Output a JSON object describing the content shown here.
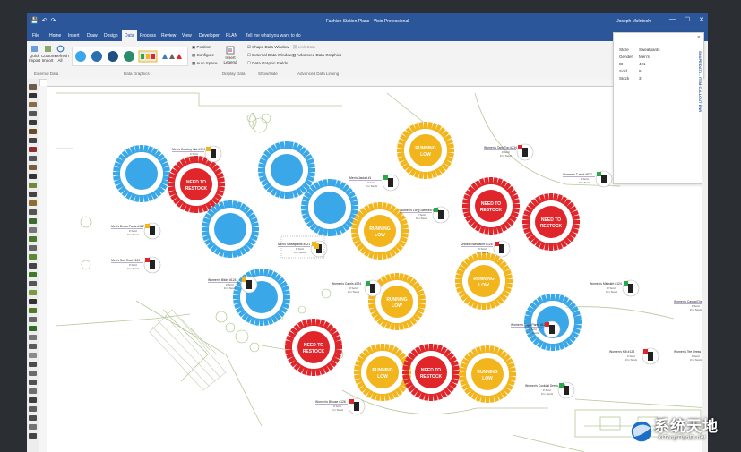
{
  "app": {
    "title": "Fashion Station Plans - Visio Professional",
    "user": "Joseph McIntosh",
    "min": "—",
    "max": "☐",
    "close": "✕",
    "qat": [
      "💾",
      "↶",
      "↷"
    ]
  },
  "menu": {
    "tabs": [
      "File",
      "Home",
      "Insert",
      "Draw",
      "Design",
      "Data",
      "Process",
      "Review",
      "View",
      "Developer",
      "PLAN"
    ],
    "active": "Data",
    "tellme": "Tell me what you want to do"
  },
  "ribbon": {
    "external": {
      "quick": "Quick Import",
      "custom": "Custom Import",
      "refresh": "Refresh All",
      "label": "External Data"
    },
    "graphics": {
      "label": "Data Graphics"
    },
    "position": {
      "position": "Position",
      "configure": "Configure",
      "autospace": "Auto Space"
    },
    "legend": {
      "insert": "Insert Legend",
      "label": "Display Data"
    },
    "showhide": {
      "shape_window": "Shape Data Window",
      "ext_window": "External Data Window",
      "fields": "Data Graphic Fields",
      "label": "Show/Hide"
    },
    "advanced": {
      "link": "Link Data",
      "graphics": "Advanced Data Graphics",
      "label": "Advanced Data Linking"
    }
  },
  "shape_data": {
    "title": "SHAPE DATA - ITEM CALLOUT ENR",
    "rows": [
      {
        "k": "Store",
        "v": "Sweatpants"
      },
      {
        "k": "Gender",
        "v": "Men's"
      },
      {
        "k": "ID",
        "v": "421"
      },
      {
        "k": "Sold",
        "v": "9"
      },
      {
        "k": "Stock",
        "v": "3"
      }
    ]
  },
  "colors": {
    "blue": "#3aa8e8",
    "red": "#e0262a",
    "yellow": "#f2b51c",
    "green": "#2ba84a"
  },
  "rings": [
    {
      "label": "",
      "color": "blue"
    },
    {
      "label": "NEED TO RESTOCK",
      "color": "red"
    },
    {
      "label": "",
      "color": "blue"
    },
    {
      "label": "",
      "color": "blue"
    },
    {
      "label": "",
      "color": "blue"
    },
    {
      "label": "RUNNING LOW",
      "color": "yellow"
    },
    {
      "label": "RUNNING LOW",
      "color": "yellow"
    },
    {
      "label": "NEED TO RESTOCK",
      "color": "red"
    },
    {
      "label": "NEED TO RESTOCK",
      "color": "red"
    },
    {
      "label": "",
      "color": "blue"
    },
    {
      "label": "RUNNING LOW",
      "color": "yellow"
    },
    {
      "label": "RUNNING LOW",
      "color": "yellow"
    },
    {
      "label": "NEED TO RESTOCK",
      "color": "red"
    },
    {
      "label": "RUNNING LOW",
      "color": "yellow"
    },
    {
      "label": "NEED TO RESTOCK",
      "color": "red"
    },
    {
      "label": "RUNNING LOW",
      "color": "yellow"
    },
    {
      "label": "",
      "color": "blue"
    }
  ],
  "callouts": [
    {
      "name": "Men's Cowboy Hat #124",
      "sold": "# Sold",
      "stock": "# in Stock",
      "flag": "yellow"
    },
    {
      "name": "Men's Dress Pants #122",
      "sold": "# Sold",
      "stock": "# in Stock",
      "flag": "yellow"
    },
    {
      "name": "Men's Suit Coat #121",
      "sold": "# Sold",
      "stock": "# in Stock",
      "flag": "red"
    },
    {
      "name": "Men's Jacket #1",
      "sold": "# Sold",
      "stock": "# in Stock",
      "flag": "green"
    },
    {
      "name": "Men's Sweatpants #421",
      "sold": "# Sold",
      "stock": "# in Stock",
      "flag": "yellow"
    },
    {
      "name": "Women's Bikini #124",
      "sold": "# Sold",
      "stock": "# in Stock",
      "flag": "yellow"
    },
    {
      "name": "Women's Capris #224",
      "sold": "# Sold",
      "stock": "# in Stock",
      "flag": "green"
    },
    {
      "name": "Women's Long Sleeved #124",
      "sold": "# Sold",
      "stock": "# in Stock",
      "flag": "green"
    },
    {
      "name": "Unisex Sweatshirt #126",
      "sold": "# Sold",
      "stock": "# in Stock",
      "flag": "red"
    },
    {
      "name": "Women's Tank Top #234",
      "sold": "# Sold",
      "stock": "# in Stock",
      "flag": "red"
    },
    {
      "name": "Women's T-shirt #527",
      "sold": "# Sold",
      "stock": "# in Stock",
      "flag": "green"
    },
    {
      "name": "Women's Yoga Pants #124",
      "sold": "# Sold",
      "stock": "# in Stock",
      "flag": "red"
    },
    {
      "name": "Women's Miniskirt #124",
      "sold": "# Sold",
      "stock": "# in Stock",
      "flag": "green"
    },
    {
      "name": "Women's Casual Dress #124",
      "sold": "# Sold",
      "stock": "# in Stock",
      "flag": "red"
    },
    {
      "name": "Women's Blouse #126",
      "sold": "# Sold",
      "stock": "# in Stock",
      "flag": "red"
    },
    {
      "name": "Women's Cocktail Dress #124",
      "sold": "# Sold",
      "stock": "# in Stock",
      "flag": "green"
    },
    {
      "name": "Women's Tee Dress #124",
      "sold": "# Sold",
      "stock": "# in Stock",
      "flag": "red"
    },
    {
      "name": "Women's Kilt #124",
      "sold": "# Sold",
      "stock": "# in Stock",
      "flag": "red"
    }
  ],
  "watermark": {
    "cn": "系统天地",
    "en": "XiTongTianDi.net"
  }
}
